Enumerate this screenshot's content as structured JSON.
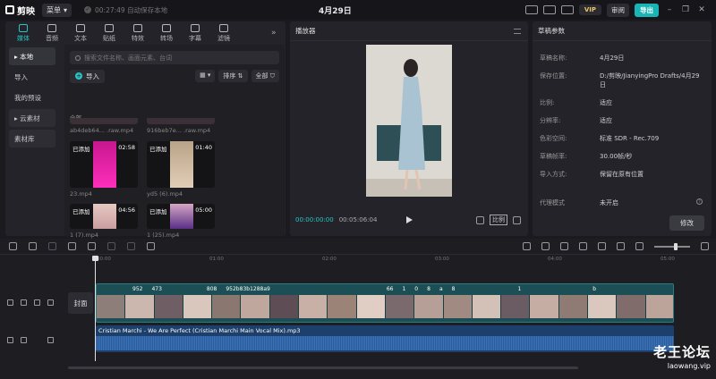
{
  "app": {
    "name": "剪映",
    "menu_label": "菜单",
    "autosave_text": "00:27:49 自动保存本地",
    "project_title": "4月29日",
    "vip_label": "VIP",
    "review_label": "审阅",
    "export_label": "导出"
  },
  "media_tabs": [
    {
      "label": "媒体",
      "icon": "media-icon",
      "active": true
    },
    {
      "label": "音频",
      "icon": "audio-icon"
    },
    {
      "label": "文本",
      "icon": "text-icon"
    },
    {
      "label": "贴纸",
      "icon": "sticker-icon"
    },
    {
      "label": "特效",
      "icon": "effects-icon"
    },
    {
      "label": "转场",
      "icon": "transition-icon"
    },
    {
      "label": "字幕",
      "icon": "subtitle-icon"
    },
    {
      "label": "滤镜",
      "icon": "filter-icon"
    }
  ],
  "media_side": {
    "local": "本地",
    "import": "导入",
    "my_presets": "我的预设",
    "cloud": "云素材",
    "library": "素材库"
  },
  "media_browser": {
    "search_placeholder": "搜索文件名称、画面元素、台词",
    "import_label": "导入",
    "sort_label": "排序",
    "all_filter": "全部",
    "all_label": "全部",
    "top_partial": [
      "ab4deb64... .raw.mp4",
      "916beb7e... .raw.mp4"
    ],
    "items": [
      {
        "added": "已添加",
        "duration": "02:58",
        "name": "23.mp4"
      },
      {
        "added": "已添加",
        "duration": "01:40",
        "name": "yd5 (6).mp4"
      },
      {
        "added": "已添加",
        "duration": "04:56",
        "name": "1 (7).mp4"
      },
      {
        "added": "已添加",
        "duration": "05:00",
        "name": "1 (25).mp4"
      }
    ]
  },
  "player": {
    "title": "播放器",
    "current_time": "00:00:00:00",
    "total_time": "00:05:06:04",
    "ratio_label": "比例"
  },
  "draft": {
    "title": "草稿参数",
    "rows": [
      {
        "label": "草稿名称:",
        "value": "4月29日"
      },
      {
        "label": "保存位置:",
        "value": "D:/剪映/JianyingPro Drafts/4月29日"
      },
      {
        "label": "比例:",
        "value": "适应"
      },
      {
        "label": "分辨率:",
        "value": "适应"
      },
      {
        "label": "色彩空间:",
        "value": "标准 SDR - Rec.709"
      },
      {
        "label": "草稿帧率:",
        "value": "30.00帧/秒"
      },
      {
        "label": "导入方式:",
        "value": "保留在原有位置"
      },
      {
        "label": "代理模式",
        "value": "未开启"
      }
    ],
    "modify_label": "修改"
  },
  "timeline": {
    "ruler": [
      "00:00",
      "01:00",
      "02:00",
      "03:00",
      "04:00",
      "05:00"
    ],
    "cover_label": "封面",
    "video_labels": [
      "952",
      "473",
      "808",
      "952b83b1288a9",
      "66",
      "1",
      "0",
      "8",
      "a",
      "8",
      "1",
      "b"
    ],
    "audio_clip": "Cristian Marchi - We Are Perfect (Cristian Marchi Main Vocal Mix).mp3"
  },
  "watermark": {
    "line1": "老王论坛",
    "line2": "laowang.vip"
  }
}
